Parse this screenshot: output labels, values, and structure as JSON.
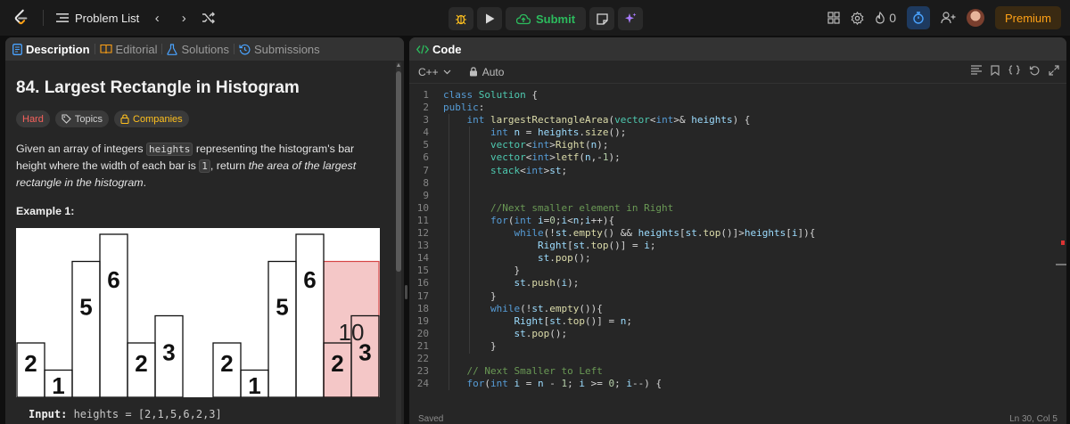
{
  "topbar": {
    "problem_list": "Problem List",
    "submit": "Submit",
    "streak": "0",
    "premium": "Premium"
  },
  "left_tabs": [
    {
      "label": "Description",
      "icon": "document-icon",
      "active": true
    },
    {
      "label": "Editorial",
      "icon": "book-icon",
      "active": false
    },
    {
      "label": "Solutions",
      "icon": "flask-icon",
      "active": false
    },
    {
      "label": "Submissions",
      "icon": "history-icon",
      "active": false
    }
  ],
  "problem": {
    "title": "84. Largest Rectangle in Histogram",
    "difficulty": "Hard",
    "topics": "Topics",
    "companies": "Companies",
    "s1": "Given an array of integers ",
    "c1": "heights",
    "s2": " representing the histogram's bar height where the width of each bar is ",
    "c2": "1",
    "s3": ", return ",
    "s4": "the area of the largest rectangle in the histogram",
    "s5": ".",
    "example_title": "Example 1:",
    "input_label": "Input:",
    "input_value": " heights = [2,1,5,6,2,3]"
  },
  "histogram": {
    "groups": [
      {
        "heights": [
          2,
          1,
          5,
          6,
          2,
          3
        ],
        "highlight": []
      },
      {
        "heights": [
          2,
          1,
          5,
          6,
          2,
          3
        ],
        "highlight": [
          2,
          3
        ]
      }
    ],
    "highlight_label": "10",
    "max_height": 6
  },
  "editor": {
    "title": "Code",
    "language": "C++",
    "mode": "Auto",
    "status": "Saved",
    "position": "Ln 30, Col 5"
  },
  "code_lines": [
    {
      "n": "1",
      "t": [
        [
          "kw",
          "class "
        ],
        [
          "ty",
          "Solution"
        ],
        [
          "ct",
          " {"
        ]
      ]
    },
    {
      "n": "2",
      "t": [
        [
          "kw",
          "public"
        ],
        [
          "ct",
          ":"
        ]
      ]
    },
    {
      "n": "3",
      "t": [
        [
          "ct",
          "    "
        ],
        [
          "kw",
          "int "
        ],
        [
          "fn",
          "largestRectangleArea"
        ],
        [
          "ct",
          "("
        ],
        [
          "ty",
          "vector"
        ],
        [
          "ct",
          "<"
        ],
        [
          "kw",
          "int"
        ],
        [
          "ct",
          ">& "
        ],
        [
          "vr",
          "heights"
        ],
        [
          "ct",
          ") {"
        ]
      ]
    },
    {
      "n": "4",
      "t": [
        [
          "ct",
          "        "
        ],
        [
          "kw",
          "int "
        ],
        [
          "vr",
          "n"
        ],
        [
          "ct",
          " = "
        ],
        [
          "vr",
          "heights"
        ],
        [
          "ct",
          "."
        ],
        [
          "fn",
          "size"
        ],
        [
          "ct",
          "();"
        ]
      ]
    },
    {
      "n": "5",
      "t": [
        [
          "ct",
          "        "
        ],
        [
          "ty",
          "vector"
        ],
        [
          "ct",
          "<"
        ],
        [
          "kw",
          "int"
        ],
        [
          "ct",
          ">"
        ],
        [
          "fn",
          "Right"
        ],
        [
          "ct",
          "("
        ],
        [
          "vr",
          "n"
        ],
        [
          "ct",
          ");"
        ]
      ]
    },
    {
      "n": "6",
      "t": [
        [
          "ct",
          "        "
        ],
        [
          "ty",
          "vector"
        ],
        [
          "ct",
          "<"
        ],
        [
          "kw",
          "int"
        ],
        [
          "ct",
          ">"
        ],
        [
          "fn",
          "letf"
        ],
        [
          "ct",
          "("
        ],
        [
          "vr",
          "n"
        ],
        [
          "ct",
          ",-"
        ],
        [
          "nm",
          "1"
        ],
        [
          "ct",
          ");"
        ]
      ]
    },
    {
      "n": "7",
      "t": [
        [
          "ct",
          "        "
        ],
        [
          "ty",
          "stack"
        ],
        [
          "ct",
          "<"
        ],
        [
          "kw",
          "int"
        ],
        [
          "ct",
          ">"
        ],
        [
          "vr",
          "st"
        ],
        [
          "ct",
          ";"
        ]
      ]
    },
    {
      "n": "8",
      "t": []
    },
    {
      "n": "9",
      "t": []
    },
    {
      "n": "10",
      "t": [
        [
          "ct",
          "        "
        ],
        [
          "cm",
          "//Next smaller element in Right"
        ]
      ]
    },
    {
      "n": "11",
      "t": [
        [
          "ct",
          "        "
        ],
        [
          "kw",
          "for"
        ],
        [
          "ct",
          "("
        ],
        [
          "kw",
          "int "
        ],
        [
          "vr",
          "i"
        ],
        [
          "ct",
          "="
        ],
        [
          "nm",
          "0"
        ],
        [
          "ct",
          ";"
        ],
        [
          "vr",
          "i"
        ],
        [
          "ct",
          "<"
        ],
        [
          "vr",
          "n"
        ],
        [
          "ct",
          ";"
        ],
        [
          "vr",
          "i"
        ],
        [
          "ct",
          "++){"
        ]
      ]
    },
    {
      "n": "12",
      "t": [
        [
          "ct",
          "            "
        ],
        [
          "kw",
          "while"
        ],
        [
          "ct",
          "(!"
        ],
        [
          "vr",
          "st"
        ],
        [
          "ct",
          "."
        ],
        [
          "fn",
          "empty"
        ],
        [
          "ct",
          "() && "
        ],
        [
          "vr",
          "heights"
        ],
        [
          "ct",
          "["
        ],
        [
          "vr",
          "st"
        ],
        [
          "ct",
          "."
        ],
        [
          "fn",
          "top"
        ],
        [
          "ct",
          "()]>"
        ],
        [
          "vr",
          "heights"
        ],
        [
          "ct",
          "["
        ],
        [
          "vr",
          "i"
        ],
        [
          "ct",
          "]){"
        ]
      ]
    },
    {
      "n": "13",
      "t": [
        [
          "ct",
          "                "
        ],
        [
          "vr",
          "Right"
        ],
        [
          "ct",
          "["
        ],
        [
          "vr",
          "st"
        ],
        [
          "ct",
          "."
        ],
        [
          "fn",
          "top"
        ],
        [
          "ct",
          "()] = "
        ],
        [
          "vr",
          "i"
        ],
        [
          "ct",
          ";"
        ]
      ]
    },
    {
      "n": "14",
      "t": [
        [
          "ct",
          "                "
        ],
        [
          "vr",
          "st"
        ],
        [
          "ct",
          "."
        ],
        [
          "fn",
          "pop"
        ],
        [
          "ct",
          "();"
        ]
      ]
    },
    {
      "n": "15",
      "t": [
        [
          "ct",
          "            }"
        ]
      ]
    },
    {
      "n": "16",
      "t": [
        [
          "ct",
          "            "
        ],
        [
          "vr",
          "st"
        ],
        [
          "ct",
          "."
        ],
        [
          "fn",
          "push"
        ],
        [
          "ct",
          "("
        ],
        [
          "vr",
          "i"
        ],
        [
          "ct",
          ");"
        ]
      ]
    },
    {
      "n": "17",
      "t": [
        [
          "ct",
          "        }"
        ]
      ]
    },
    {
      "n": "18",
      "t": [
        [
          "ct",
          "        "
        ],
        [
          "kw",
          "while"
        ],
        [
          "ct",
          "(!"
        ],
        [
          "vr",
          "st"
        ],
        [
          "ct",
          "."
        ],
        [
          "fn",
          "empty"
        ],
        [
          "ct",
          "()){"
        ]
      ]
    },
    {
      "n": "19",
      "t": [
        [
          "ct",
          "            "
        ],
        [
          "vr",
          "Right"
        ],
        [
          "ct",
          "["
        ],
        [
          "vr",
          "st"
        ],
        [
          "ct",
          "."
        ],
        [
          "fn",
          "top"
        ],
        [
          "ct",
          "()] = "
        ],
        [
          "vr",
          "n"
        ],
        [
          "ct",
          ";"
        ]
      ]
    },
    {
      "n": "20",
      "t": [
        [
          "ct",
          "            "
        ],
        [
          "vr",
          "st"
        ],
        [
          "ct",
          "."
        ],
        [
          "fn",
          "pop"
        ],
        [
          "ct",
          "();"
        ]
      ]
    },
    {
      "n": "21",
      "t": [
        [
          "ct",
          "        }"
        ]
      ]
    },
    {
      "n": "22",
      "t": []
    },
    {
      "n": "23",
      "t": [
        [
          "ct",
          "    "
        ],
        [
          "cm",
          "// Next Smaller to Left"
        ]
      ]
    },
    {
      "n": "24",
      "t": [
        [
          "ct",
          "    "
        ],
        [
          "kw",
          "for"
        ],
        [
          "ct",
          "("
        ],
        [
          "kw",
          "int "
        ],
        [
          "vr",
          "i"
        ],
        [
          "ct",
          " = "
        ],
        [
          "vr",
          "n"
        ],
        [
          "ct",
          " - "
        ],
        [
          "nm",
          "1"
        ],
        [
          "ct",
          "; "
        ],
        [
          "vr",
          "i"
        ],
        [
          "ct",
          " >= "
        ],
        [
          "nm",
          "0"
        ],
        [
          "ct",
          "; "
        ],
        [
          "vr",
          "i"
        ],
        [
          "ct",
          "--) {"
        ]
      ]
    }
  ],
  "colors": {
    "accent_green": "#2cbb5d",
    "hard_red": "#f8615c",
    "premium_orange": "#ffa116",
    "highlight_fill": "#f4c7c7",
    "highlight_stroke": "#d64545"
  }
}
